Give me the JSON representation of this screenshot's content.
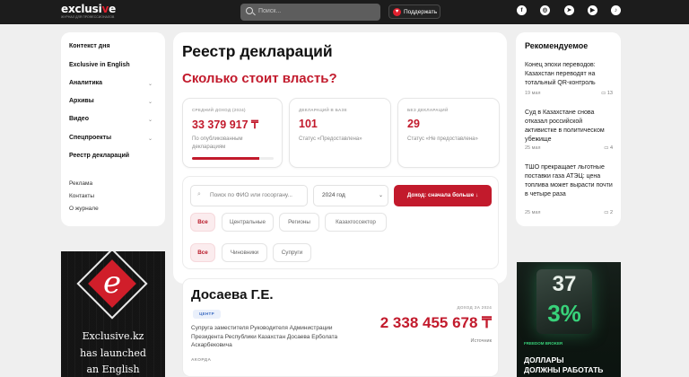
{
  "header": {
    "logo_pre": "exclusi",
    "logo_accent": "v",
    "logo_post": "e",
    "logo_tagline": "ЖУРНАЛ ДЛЯ ПРОФЕССИОНАЛОВ",
    "search_placeholder": "Поиск...",
    "support_label": "Поддержать",
    "social_icons": [
      "facebook-icon",
      "instagram-icon",
      "telegram-icon",
      "youtube-icon",
      "tiktok-icon"
    ],
    "background": "#1c1c1c"
  },
  "sidebar": {
    "items": [
      {
        "label": "Контекст дня",
        "has_chevron": false
      },
      {
        "label": "Exclusive in English",
        "has_chevron": false
      },
      {
        "label": "Аналитика",
        "has_chevron": true
      },
      {
        "label": "Архивы",
        "has_chevron": true
      },
      {
        "label": "Видео",
        "has_chevron": true
      },
      {
        "label": "Спецпроекты",
        "has_chevron": true
      },
      {
        "label": "Реестр деклараций",
        "has_chevron": false
      }
    ],
    "links": [
      "Реклама",
      "Контакты",
      "О журнале"
    ]
  },
  "banner_left": {
    "letter": "e",
    "lines": [
      "Exclusive.kz",
      "has launched",
      "an English"
    ]
  },
  "main": {
    "title": "Реестр деклараций",
    "subtitle": "Сколько стоит власть?",
    "stats": [
      {
        "caption": "СРЕДНИЙ ДОХОД (2024)",
        "value": "33 379 917 ₸",
        "desc": "По опубликованным декларациям",
        "progress": 0.82
      },
      {
        "caption": "ДЕКЛАРАЦИЙ В БАЗЕ",
        "value": "101",
        "desc": "Статус «Предоставлена»"
      },
      {
        "caption": "БЕЗ ДЕКЛАРАЦИЙ",
        "value": "29",
        "desc": "Статус «Не предоставлена»"
      }
    ],
    "filters": {
      "search_placeholder": "Поиск по ФИО или госоргану...",
      "year": "2024 год",
      "sort_button": "Доход: сначала больше ↓",
      "chips_row1": [
        "Все",
        "Центральные",
        "Регионы",
        "Казахгоссектор"
      ],
      "chips_row2": [
        "Все",
        "Чиновники",
        "Супруги"
      ]
    },
    "declaration": {
      "name": "Досаева Г.Е.",
      "tag": "ЦЕНТР",
      "description": "Супруга заместителя Руководителя Администрации Президента Республики Казахстан Досаева Ерболата Аскарбековича",
      "location": "АКОРДА",
      "income_caption": "ДОХОД ЗА 2024",
      "income_value": "2 338 455 678 ₸",
      "income_source": "Источник"
    },
    "accent_color": "#c21a2c"
  },
  "recommended": {
    "title": "Рекомендуемое",
    "items": [
      {
        "text": "Конец эпохи переводов: Казахстан переводят на тотальный QR-контроль",
        "date": "19 мая",
        "comments": "13"
      },
      {
        "text": "Суд в Казахстане снова отказал российской активистке в политическом убежище",
        "date": "25 мая",
        "comments": "4"
      },
      {
        "text": "ТШО прекращает льготные поставки газа АТЭЦ: цена топлива может вырасти почти в четыре раза",
        "date": "25 мая",
        "comments": "2"
      }
    ]
  },
  "banner_right": {
    "top": "37",
    "bottom": "3%",
    "brand": "FREEDOM BROKER",
    "lines": [
      "ДОЛЛАРЫ",
      "ДОЛЖНЫ РАБОТАТЬ"
    ]
  }
}
